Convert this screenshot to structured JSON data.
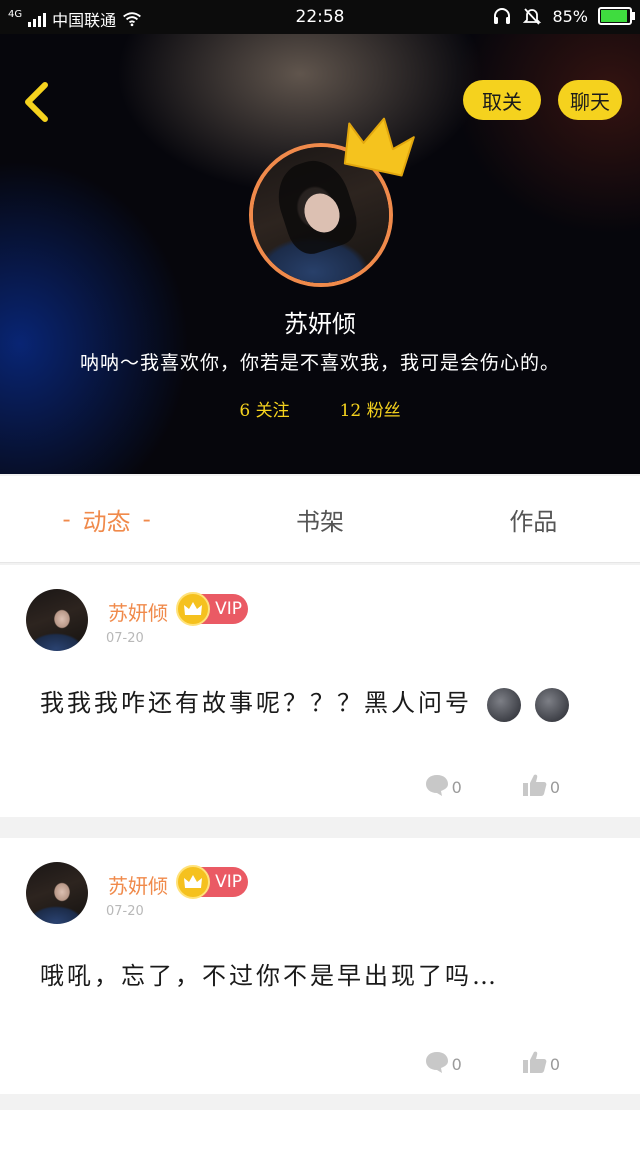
{
  "status_bar": {
    "network": "4G",
    "carrier": "中国联通",
    "time": "22:58",
    "battery": "85%"
  },
  "header": {
    "unfollow_label": "取关",
    "chat_label": "聊天",
    "username": "苏妍倾",
    "bio": "呐呐～我喜欢你，你若是不喜欢我，我可是会伤心的。",
    "following": "6 关注",
    "followers": "12 粉丝"
  },
  "tabs": [
    {
      "label": "动态",
      "active": true
    },
    {
      "label": "书架",
      "active": false
    },
    {
      "label": "作品",
      "active": false
    }
  ],
  "posts": [
    {
      "author": "苏妍倾",
      "badge": "VIP",
      "date": "07-20",
      "text": "我我我咋还有故事呢？？？黑人问号",
      "comments": "0",
      "likes": "0"
    },
    {
      "author": "苏妍倾",
      "badge": "VIP",
      "date": "07-20",
      "text": "哦吼，忘了，不过你不是早出现了吗…",
      "comments": "0",
      "likes": "0"
    }
  ],
  "colors": {
    "accent": "#f08a4b",
    "yellow": "#f5d21e",
    "vip": "#ea5a64"
  }
}
